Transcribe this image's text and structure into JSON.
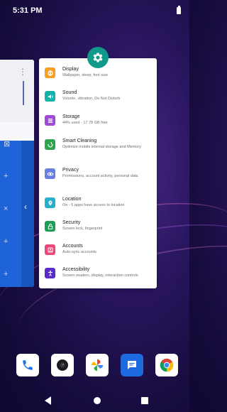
{
  "status": {
    "time": "5:31 PM"
  },
  "settings_card": {
    "items": [
      {
        "title": "Display",
        "subtitle": "Wallpaper, sleep, font size",
        "icon": "display-icon",
        "color": "#f4a024"
      },
      {
        "title": "Sound",
        "subtitle": "Volume, vibration, Do Not Disturb",
        "icon": "sound-icon",
        "color": "#18b3a8"
      },
      {
        "title": "Storage",
        "subtitle": "44% used - 17.78 GB free",
        "icon": "storage-icon",
        "color": "#a04bd6"
      },
      {
        "title": "Smart Cleaning",
        "subtitle": "Optimize mobile internal storage and Memory",
        "icon": "cleaning-icon",
        "color": "#2ea44f"
      },
      {
        "title": "Privacy",
        "subtitle": "Permissions, account activity, personal data",
        "icon": "privacy-icon",
        "color": "#6b7fe0"
      },
      {
        "title": "Location",
        "subtitle": "On - 5 apps have access to location",
        "icon": "location-icon",
        "color": "#27b0c9"
      },
      {
        "title": "Security",
        "subtitle": "Screen lock, fingerprint",
        "icon": "security-icon",
        "color": "#1e9e54"
      },
      {
        "title": "Accounts",
        "subtitle": "Auto-sync accounts",
        "icon": "accounts-icon",
        "color": "#e9497a"
      },
      {
        "title": "Accessibility",
        "subtitle": "Screen readers, display, interaction controls",
        "icon": "accessibility-icon",
        "color": "#5b2bc7"
      }
    ]
  },
  "dock": [
    {
      "name": "phone-icon",
      "bg": "#ffffff"
    },
    {
      "name": "camera-icon",
      "bg": "#ffffff"
    },
    {
      "name": "photos-icon",
      "bg": "#ffffff"
    },
    {
      "name": "messages-icon",
      "bg": "#1e6be0"
    },
    {
      "name": "chrome-icon",
      "bg": "#ffffff"
    }
  ],
  "colors": {
    "settings_icon_bg": "#109a8a"
  }
}
